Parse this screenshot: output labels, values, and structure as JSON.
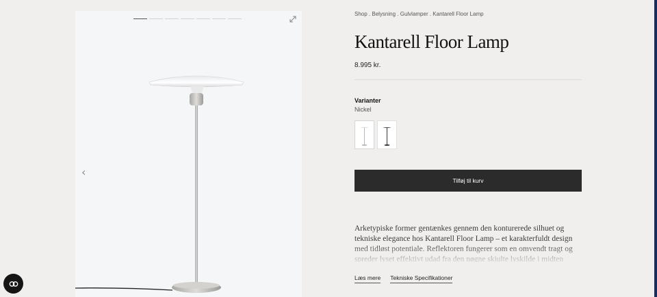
{
  "breadcrumb": {
    "items": [
      "Shop",
      "Belysning",
      "Gulvlamper",
      "Kantarell Floor Lamp"
    ],
    "separator": " . "
  },
  "product": {
    "title": "Kantarell Floor Lamp",
    "price": "8.995 kr."
  },
  "variants": {
    "label": "Varianter",
    "selected": "Nickel",
    "options": [
      "Nickel",
      "Black"
    ]
  },
  "actions": {
    "add_to_cart": "Tilføj til kurv"
  },
  "description": {
    "text": "Arketypiske former gentænkes gennem den konturerede silhuet og tekniske elegance hos Kantarell Floor Lamp – et karakterfuldt design med tidløst potentiale. Reflektoren fungerer som en omvendt tragt og spreder lyset effektivt udad fra den nøgne skjulte lyskilde i midten"
  },
  "links": {
    "read_more": "Læs mere",
    "tech_specs": "Tekniske Specifikationer"
  },
  "gallery": {
    "slide_count": 7,
    "active_slide": 1
  },
  "colors": {
    "background": "#f1efed",
    "button": "#2b2b2b",
    "gallery_bg": "#f5f6f8"
  },
  "icons": [
    "expand-icon",
    "chevron-left-icon",
    "chevron-right-icon",
    "chat-icon"
  ]
}
